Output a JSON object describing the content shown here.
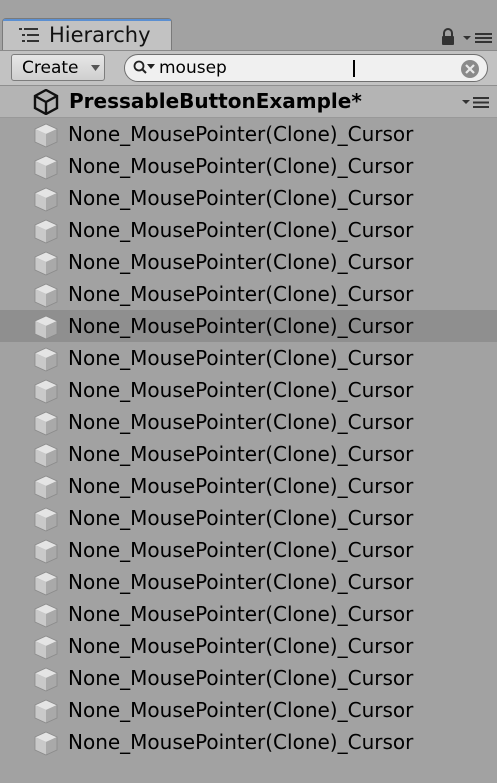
{
  "tab": {
    "title": "Hierarchy"
  },
  "toolbar": {
    "create_label": "Create",
    "search_value": "mousep"
  },
  "scene": {
    "name": "PressableButtonExample*"
  },
  "items": [
    {
      "label": "None_MousePointer(Clone)_Cursor",
      "selected": false
    },
    {
      "label": "None_MousePointer(Clone)_Cursor",
      "selected": false
    },
    {
      "label": "None_MousePointer(Clone)_Cursor",
      "selected": false
    },
    {
      "label": "None_MousePointer(Clone)_Cursor",
      "selected": false
    },
    {
      "label": "None_MousePointer(Clone)_Cursor",
      "selected": false
    },
    {
      "label": "None_MousePointer(Clone)_Cursor",
      "selected": false
    },
    {
      "label": "None_MousePointer(Clone)_Cursor",
      "selected": true
    },
    {
      "label": "None_MousePointer(Clone)_Cursor",
      "selected": false
    },
    {
      "label": "None_MousePointer(Clone)_Cursor",
      "selected": false
    },
    {
      "label": "None_MousePointer(Clone)_Cursor",
      "selected": false
    },
    {
      "label": "None_MousePointer(Clone)_Cursor",
      "selected": false
    },
    {
      "label": "None_MousePointer(Clone)_Cursor",
      "selected": false
    },
    {
      "label": "None_MousePointer(Clone)_Cursor",
      "selected": false
    },
    {
      "label": "None_MousePointer(Clone)_Cursor",
      "selected": false
    },
    {
      "label": "None_MousePointer(Clone)_Cursor",
      "selected": false
    },
    {
      "label": "None_MousePointer(Clone)_Cursor",
      "selected": false
    },
    {
      "label": "None_MousePointer(Clone)_Cursor",
      "selected": false
    },
    {
      "label": "None_MousePointer(Clone)_Cursor",
      "selected": false
    },
    {
      "label": "None_MousePointer(Clone)_Cursor",
      "selected": false
    },
    {
      "label": "None_MousePointer(Clone)_Cursor",
      "selected": false
    }
  ],
  "icons": {
    "tab": "hierarchy-list-icon",
    "lock": "lock-icon",
    "tab_menu": "panel-menu-icon",
    "search": "search-icon",
    "clear": "clear-search-icon",
    "scene": "unity-logo-icon",
    "scene_menu": "scene-menu-icon",
    "item": "gameobject-cube-icon"
  },
  "colors": {
    "selection": "#8f8f8f",
    "tab_accent": "#5b8fd1"
  }
}
